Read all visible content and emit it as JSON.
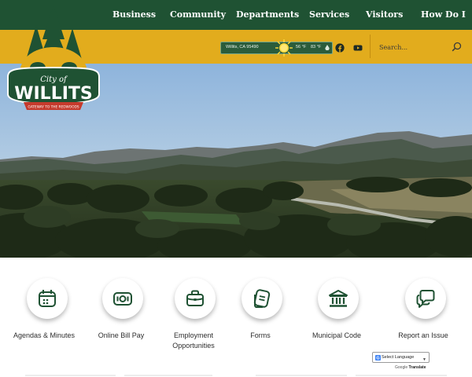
{
  "nav": {
    "items": [
      "Business",
      "Community",
      "Departments",
      "Services",
      "Visitors",
      "How Do I"
    ]
  },
  "weather": {
    "location": "Willits, CA 95490",
    "high": "56 °F",
    "low": "83 °F"
  },
  "search": {
    "placeholder": "Search..."
  },
  "logo": {
    "line1": "City of",
    "line2": "WILLITS",
    "tagline": "GATEWAY TO THE REDWOODS"
  },
  "quick_links": [
    {
      "label": "Agendas & Minutes",
      "icon": "calendar-icon"
    },
    {
      "label": "Online Bill Pay",
      "icon": "bill-icon"
    },
    {
      "label": "Employment\nOpportunities",
      "icon": "briefcase-icon"
    },
    {
      "label": "Forms",
      "icon": "forms-icon"
    },
    {
      "label": "Municipal Code",
      "icon": "courthouse-icon"
    },
    {
      "label": "Report an Issue",
      "icon": "chat-bubbles-icon"
    }
  ],
  "translate": {
    "select_label": "Select Language",
    "powered_by": "Google",
    "brand": "Translate"
  },
  "colors": {
    "nav_green": "#1f5233",
    "util_yellow": "#e2ac1d",
    "icon_green": "#1f5233"
  }
}
